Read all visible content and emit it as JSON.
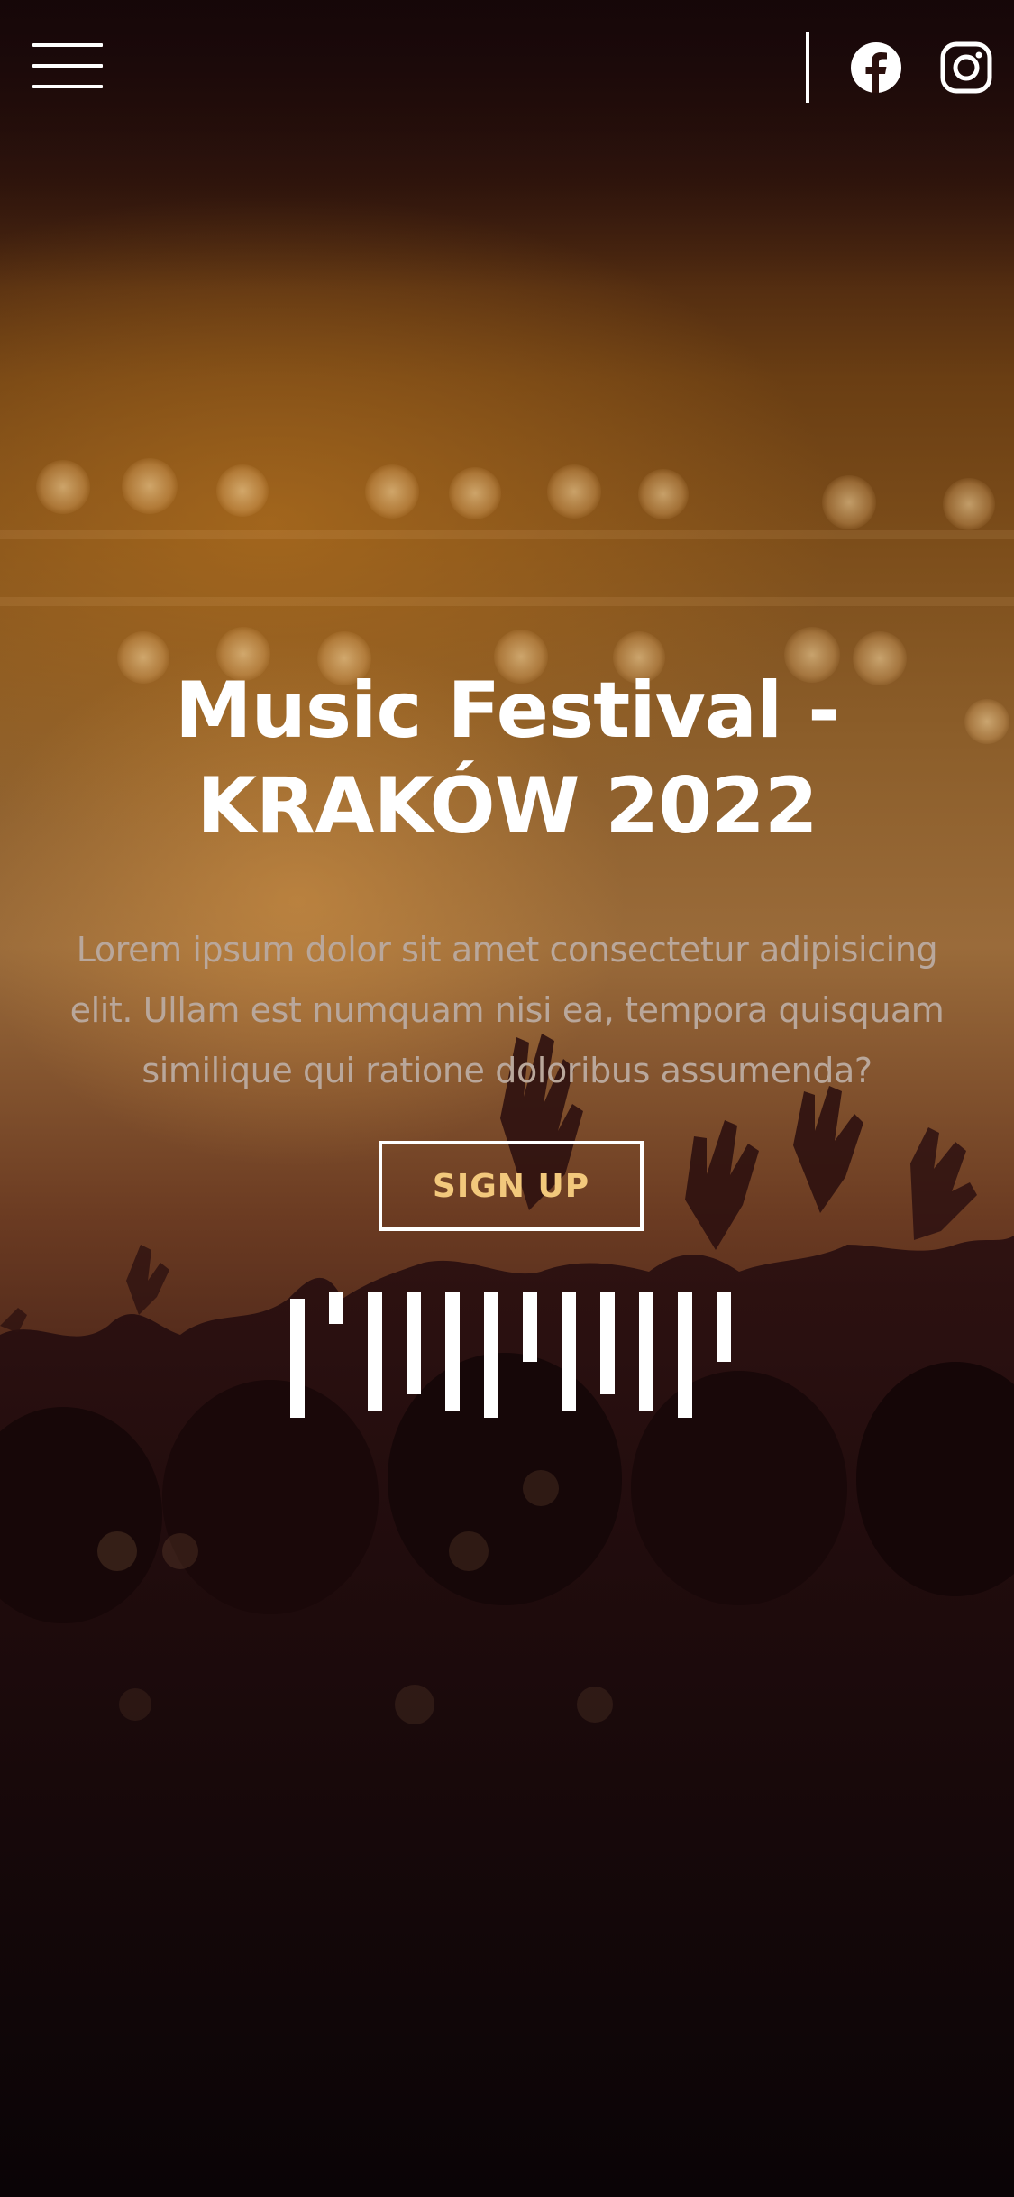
{
  "colors": {
    "accent": "#f2c87c",
    "text": "#ffffff",
    "muted_text": "#b9a79b"
  },
  "header": {
    "menu_icon": "hamburger-menu-icon",
    "social_icons": [
      "facebook-icon",
      "instagram-icon"
    ]
  },
  "hero": {
    "title_line1": "Music Festival -",
    "title_line2": "KRAKÓW 2022",
    "lead_line1": "Lorem ipsum dolor sit amet consectetur adipisicing",
    "lead_line2": "elit. Ullam est numquam nisi ea, tempora quisquam",
    "lead_line3": "similique qui ratione doloribus assumenda?",
    "signup_label": "SIGN UP",
    "equalizer_icon": "sound-wave-icon"
  }
}
